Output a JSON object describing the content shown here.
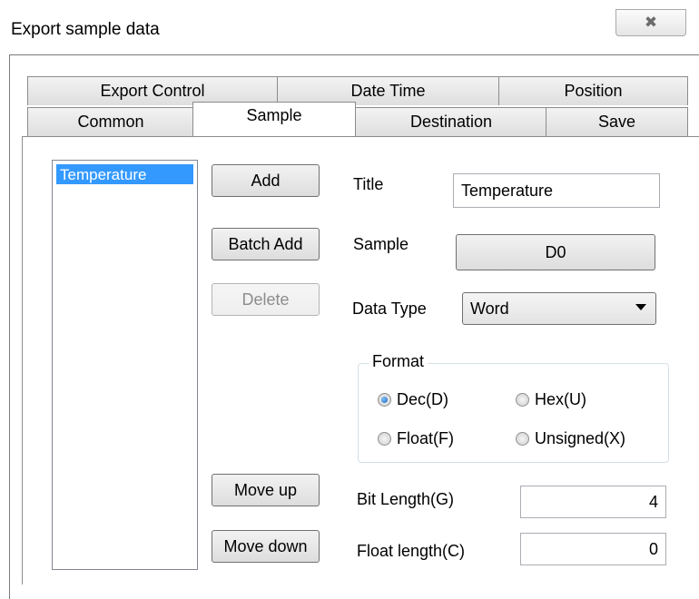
{
  "window": {
    "title": "Export sample data",
    "close_glyph": "✖",
    "close_icon": "close-icon"
  },
  "tabs": {
    "row_back": [
      "Export Control",
      "Date Time",
      "Position"
    ],
    "row_front": [
      "Common",
      "Sample",
      "Destination",
      "Save"
    ],
    "active": "Sample"
  },
  "sample_list": {
    "items": [
      "Temperature"
    ],
    "selected": "Temperature"
  },
  "buttons": {
    "add": "Add",
    "batch_add": "Batch Add",
    "delete": "Delete",
    "move_up": "Move up",
    "move_down": "Move down"
  },
  "form": {
    "title_label": "Title",
    "title_value": "Temperature",
    "sample_label": "Sample",
    "sample_value": "D0",
    "data_type_label": "Data Type",
    "data_type_value": "Word",
    "format_legend": "Format",
    "format_options": [
      "Dec(D)",
      "Hex(U)",
      "Float(F)",
      "Unsigned(X)"
    ],
    "format_selected": "Dec(D)",
    "bit_length_label": "Bit Length(G)",
    "bit_length_value": "4",
    "float_length_label": "Float length(C)",
    "float_length_value": "0"
  },
  "colors": {
    "selection": "#3399ff",
    "watermark": "#f03a2a"
  }
}
